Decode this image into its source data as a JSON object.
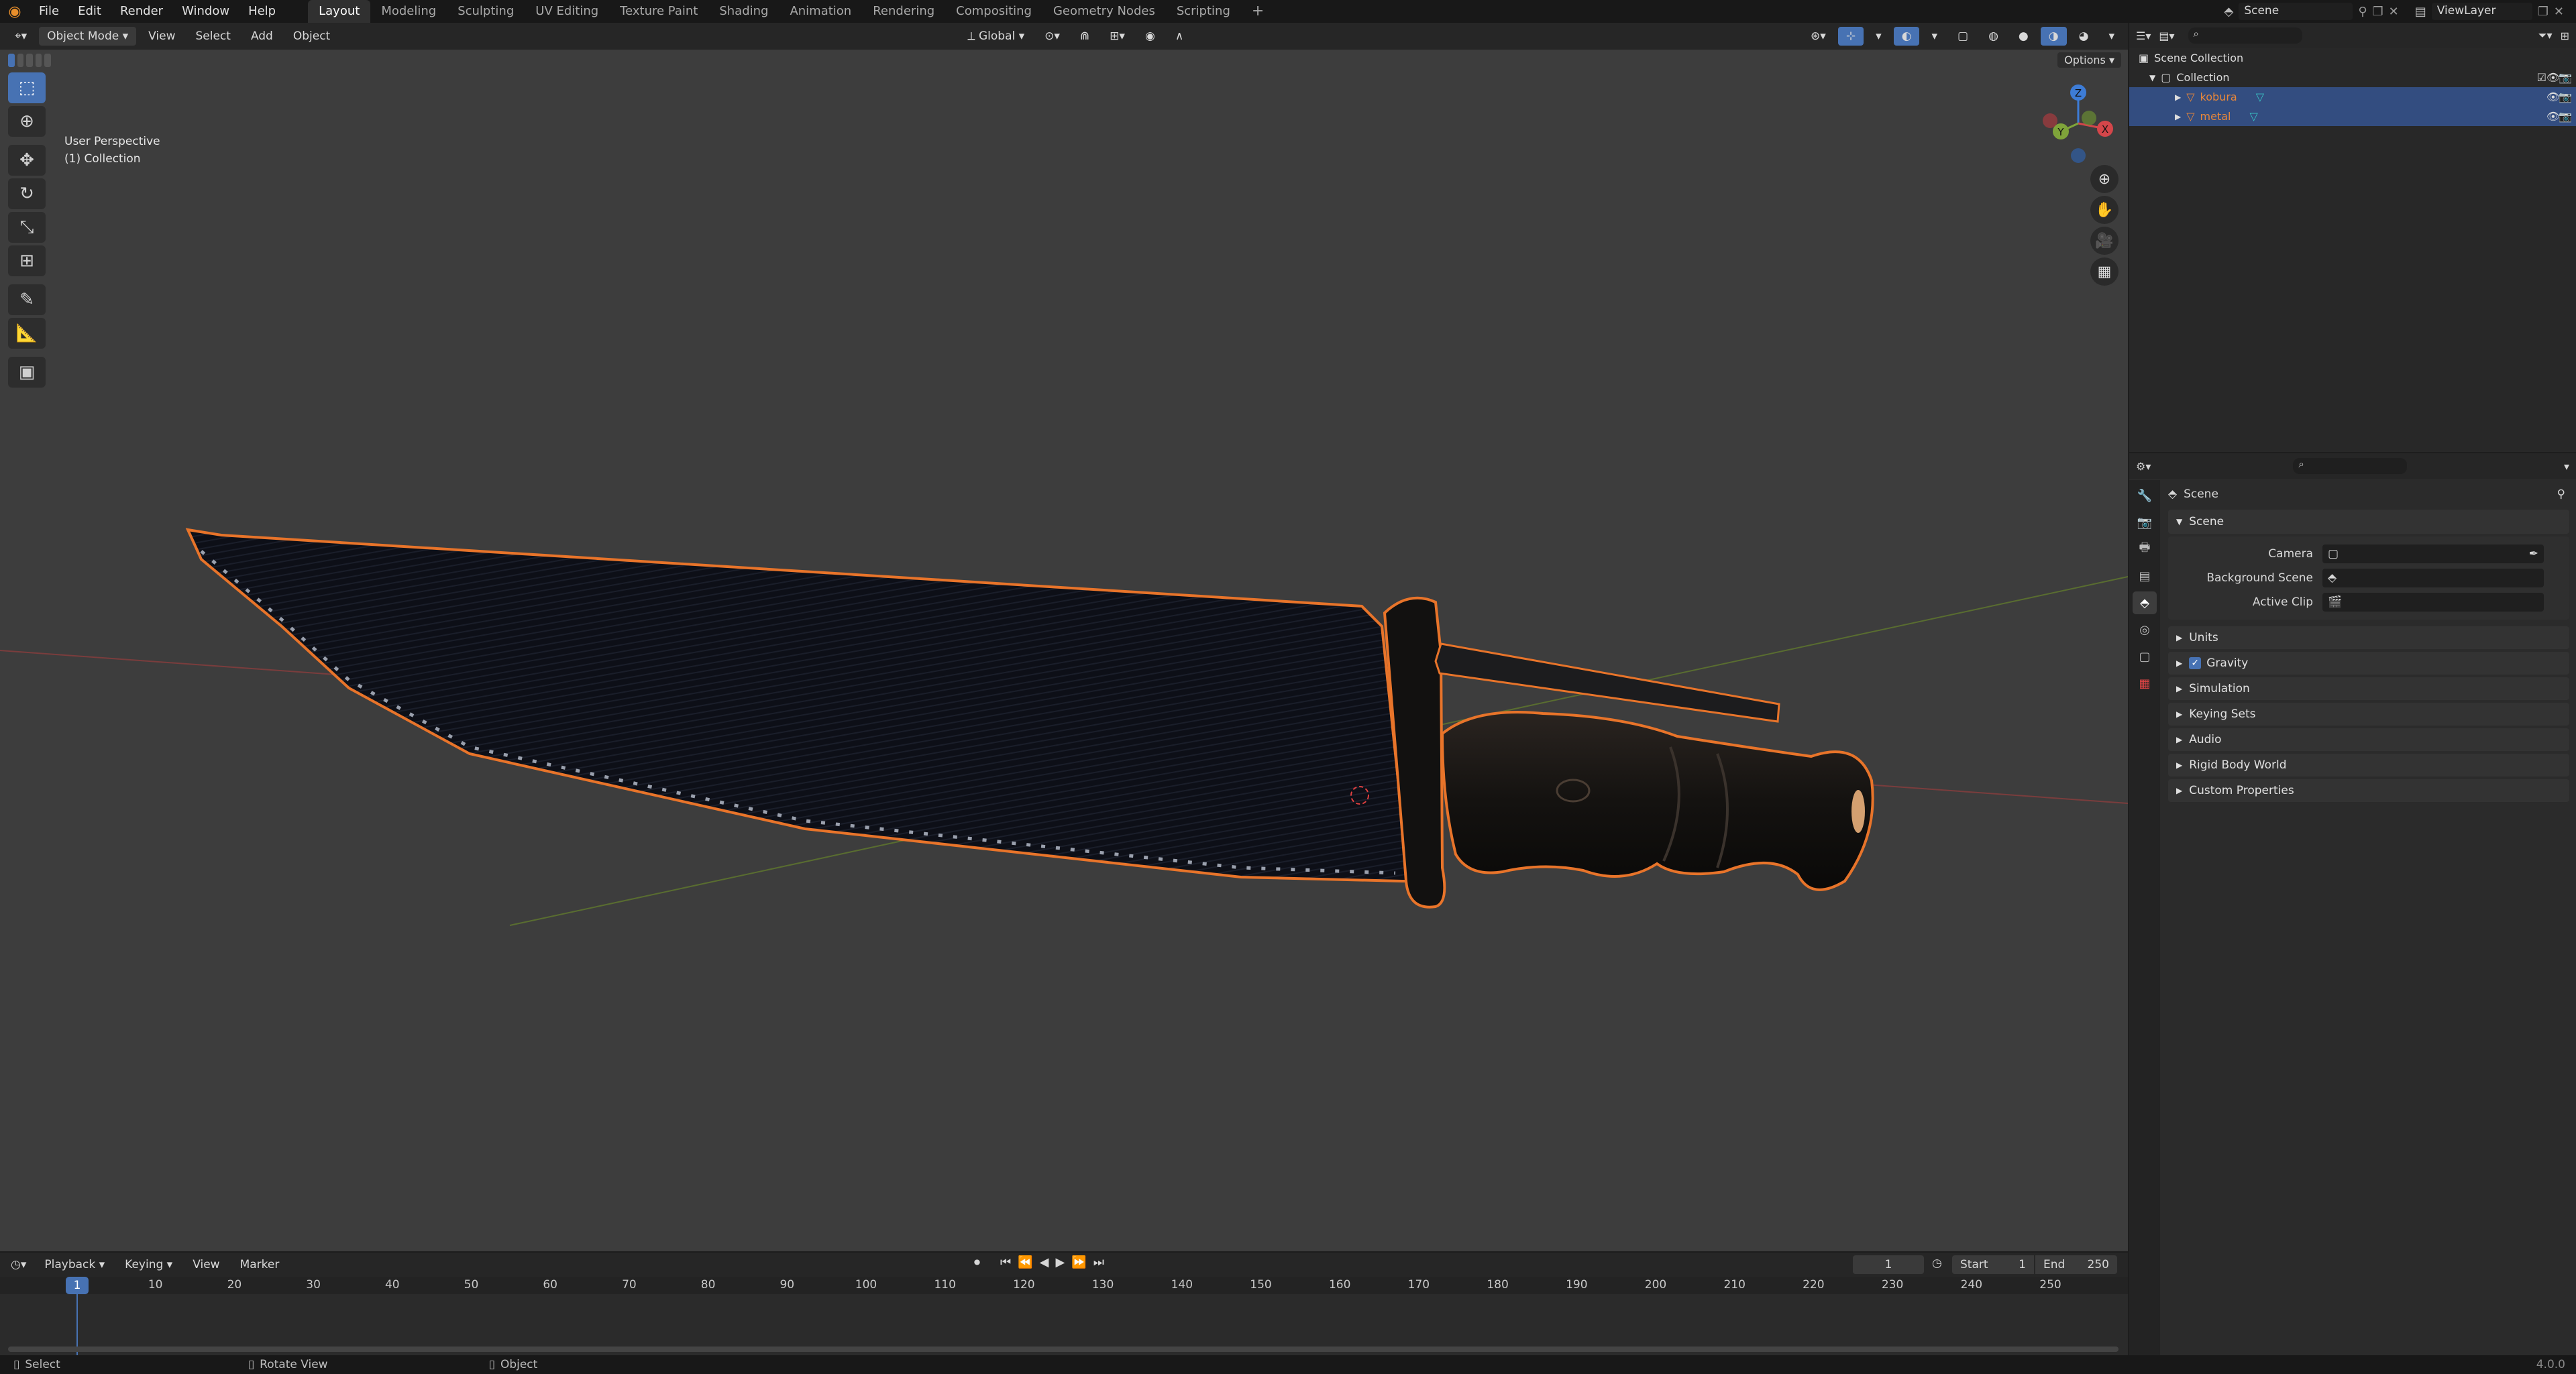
{
  "topbar": {
    "menus": [
      "File",
      "Edit",
      "Render",
      "Window",
      "Help"
    ],
    "workspaces": [
      "Layout",
      "Modeling",
      "Sculpting",
      "UV Editing",
      "Texture Paint",
      "Shading",
      "Animation",
      "Rendering",
      "Compositing",
      "Geometry Nodes",
      "Scripting"
    ],
    "active_workspace": "Layout",
    "scene_name": "Scene",
    "view_layer": "ViewLayer"
  },
  "viewport_header": {
    "mode": "Object Mode",
    "menus": [
      "View",
      "Select",
      "Add",
      "Object"
    ],
    "transform_orientation": "Global",
    "options_label": "Options"
  },
  "viewport": {
    "perspective_label": "User Perspective",
    "collection_label": "(1) Collection",
    "gizmo_axes": [
      "Z",
      "Y",
      "X"
    ]
  },
  "outliner": {
    "root": "Scene Collection",
    "collection": "Collection",
    "objects": [
      {
        "name": "kobura",
        "selected": true
      },
      {
        "name": "metal",
        "selected": true
      }
    ]
  },
  "properties": {
    "context_title": "Scene",
    "section": "Scene",
    "fields": [
      {
        "label": "Camera",
        "value": ""
      },
      {
        "label": "Background Scene",
        "value": ""
      },
      {
        "label": "Active Clip",
        "value": ""
      }
    ],
    "panels": [
      {
        "label": "Units",
        "checkbox": false
      },
      {
        "label": "Gravity",
        "checkbox": true
      },
      {
        "label": "Simulation",
        "checkbox": false
      },
      {
        "label": "Keying Sets",
        "checkbox": false
      },
      {
        "label": "Audio",
        "checkbox": false
      },
      {
        "label": "Rigid Body World",
        "checkbox": false
      },
      {
        "label": "Custom Properties",
        "checkbox": false
      }
    ]
  },
  "timeline": {
    "menus": [
      "Playback",
      "Keying",
      "View",
      "Marker"
    ],
    "current_frame": "1",
    "start_label": "Start",
    "start": "1",
    "end_label": "End",
    "end": "250",
    "playhead": "1",
    "ticks": [
      "10",
      "20",
      "30",
      "40",
      "50",
      "60",
      "70",
      "80",
      "90",
      "100",
      "110",
      "120",
      "130",
      "140",
      "150",
      "160",
      "170",
      "180",
      "190",
      "200",
      "210",
      "220",
      "230",
      "240",
      "250"
    ]
  },
  "statusbar": {
    "items": [
      "Select",
      "Rotate View",
      "Object"
    ],
    "version": "4.0.0"
  },
  "colors": {
    "accent": "#4772b3",
    "selection_outline": "#e8742a",
    "viewport_bg": "#3d3d3d",
    "axis_x": "#d4464a",
    "axis_y": "#7fa43a",
    "axis_z": "#3d7cd6",
    "selected_object_text": "#e8873a"
  }
}
